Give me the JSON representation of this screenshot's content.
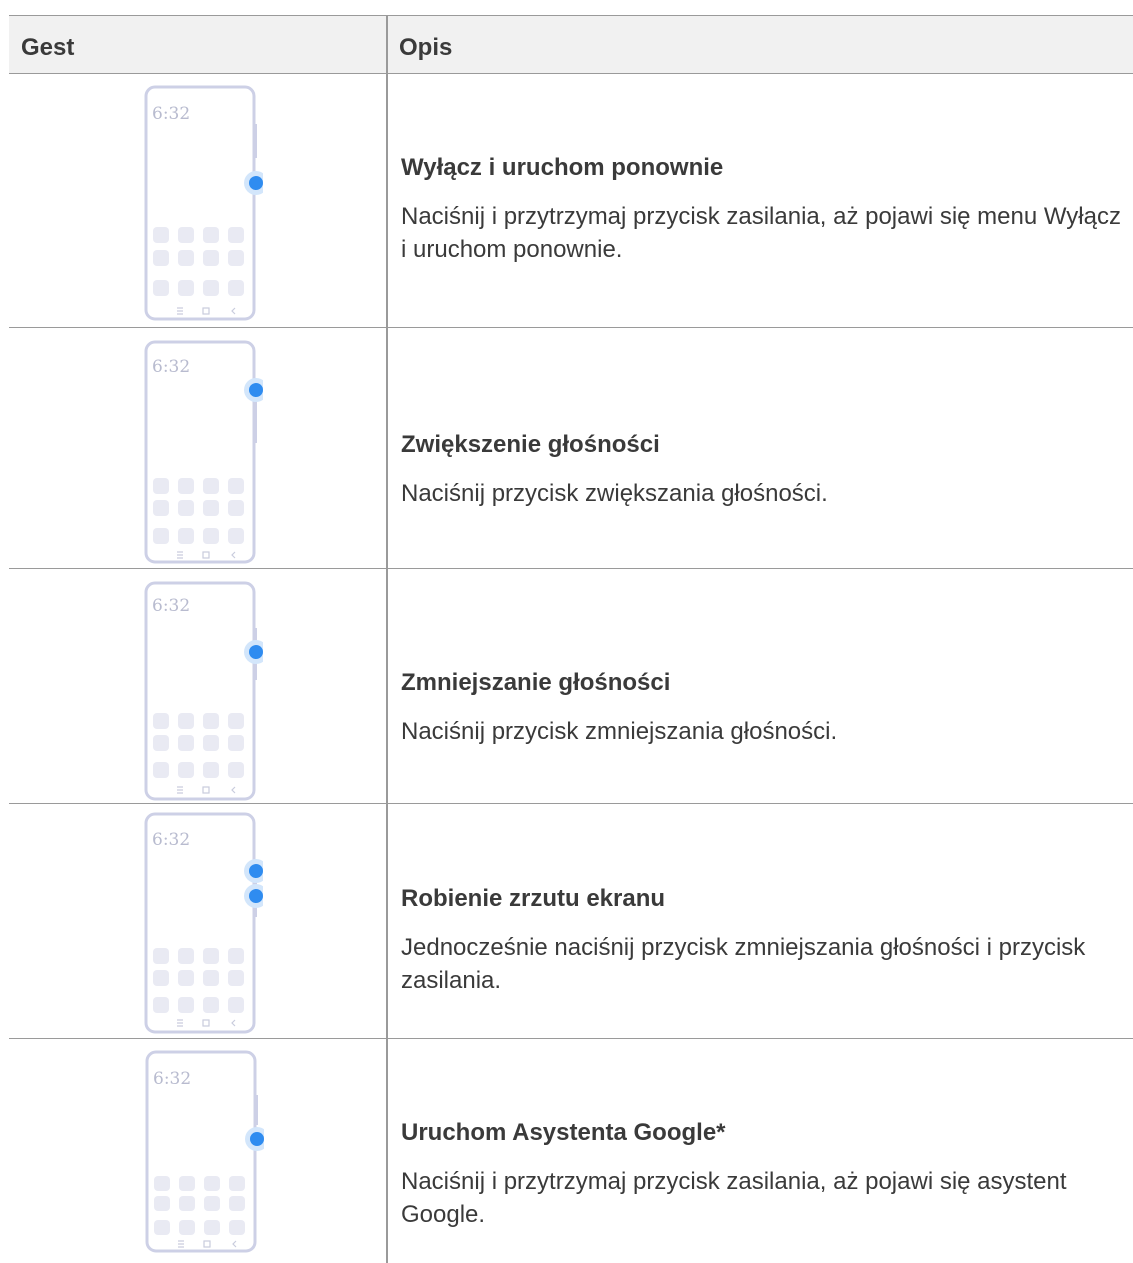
{
  "table": {
    "headers": {
      "gest": "Gest",
      "opis": "Opis"
    },
    "rows": [
      {
        "time": "6:32",
        "title": "Wyłącz i uruchom ponownie",
        "body": "Naciśnij i przytrzymaj przycisk zasilania, aż pojawi się menu Wyłącz i uruchom ponownie."
      },
      {
        "time": "6:32",
        "title": "Zwiększenie głośności",
        "body": "Naciśnij przycisk zwiększania głośności."
      },
      {
        "time": "6:32",
        "title": "Zmniejszanie głośności",
        "body": "Naciśnij przycisk zmniejszania głośności."
      },
      {
        "time": "6:32",
        "title": "Robienie zrzutu ekranu",
        "body": "Jednocześnie naciśnij przycisk zmniejszania głośności i przycisk zasilania."
      },
      {
        "time": "6:32",
        "title": "Uruchom Asystenta Google*",
        "body": "Naciśnij i przytrzymaj przycisk zasilania, aż pojawi się asystent Google."
      }
    ]
  },
  "colors": {
    "phone_outline": "#cdd0e6",
    "app_tile": "#e9eaf3",
    "press_dot": "#2f8cf0",
    "press_halo": "#d3e6fb",
    "rule": "#9a9a9a",
    "header_bg": "#f1f1f1"
  },
  "icons": {
    "nav": [
      "menu-lines-icon",
      "home-square-icon",
      "back-chevron-icon"
    ]
  }
}
